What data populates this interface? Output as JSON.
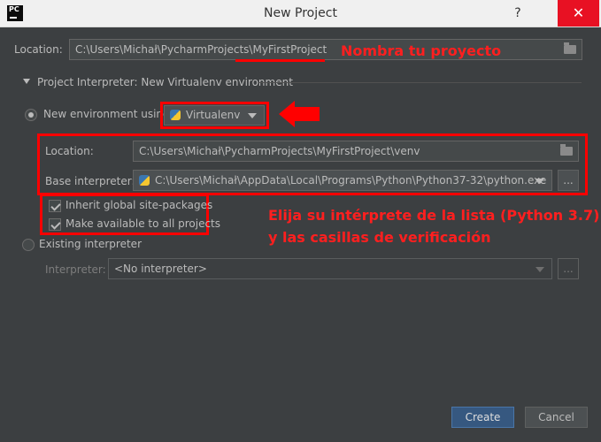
{
  "window": {
    "title": "New Project",
    "app_icon_text": "PC",
    "help_glyph": "?",
    "close_glyph": "✕"
  },
  "location": {
    "label": "Location:",
    "value_prefix": "C:\\Users\\Michał\\PycharmProjects\\",
    "value_highlight": "MyFirstProject"
  },
  "interpreter_section": {
    "title": "Project Interpreter: New Virtualenv environment",
    "new_env": {
      "label": "New environment using",
      "selected": true,
      "tool": "Virtualenv"
    },
    "venv_location": {
      "label": "Location:",
      "value": "C:\\Users\\Michał\\PycharmProjects\\MyFirstProject\\venv"
    },
    "base_interpreter": {
      "label": "Base interpreter:",
      "value": "C:\\Users\\Michał\\AppData\\Local\\Programs\\Python\\Python37-32\\python.exe",
      "browse_label": "..."
    },
    "inherit_packages": {
      "label": "Inherit global site-packages",
      "checked": true
    },
    "make_available": {
      "label": "Make available to all projects",
      "checked": true
    },
    "existing": {
      "label": "Existing interpreter",
      "selected": false,
      "interpreter_label": "Interpreter:",
      "interpreter_value": "<No interpreter>",
      "browse_label": "..."
    }
  },
  "annotations": {
    "name_project": "Nombra tu proyecto",
    "choose_line1": "Elija su intérprete de la lista (Python 3.7)",
    "choose_line2": "y las casillas de verificación"
  },
  "footer": {
    "create_label": "Create",
    "cancel_label": "Cancel"
  },
  "colors": {
    "annotation_red": "#ff1f1f",
    "dialog_bg": "#3c3f41",
    "primary_button": "#365880"
  },
  "icons": [
    "folder-icon",
    "python-icon",
    "dropdown-arrow-icon",
    "collapse-triangle-icon",
    "red-arrow-icon"
  ]
}
